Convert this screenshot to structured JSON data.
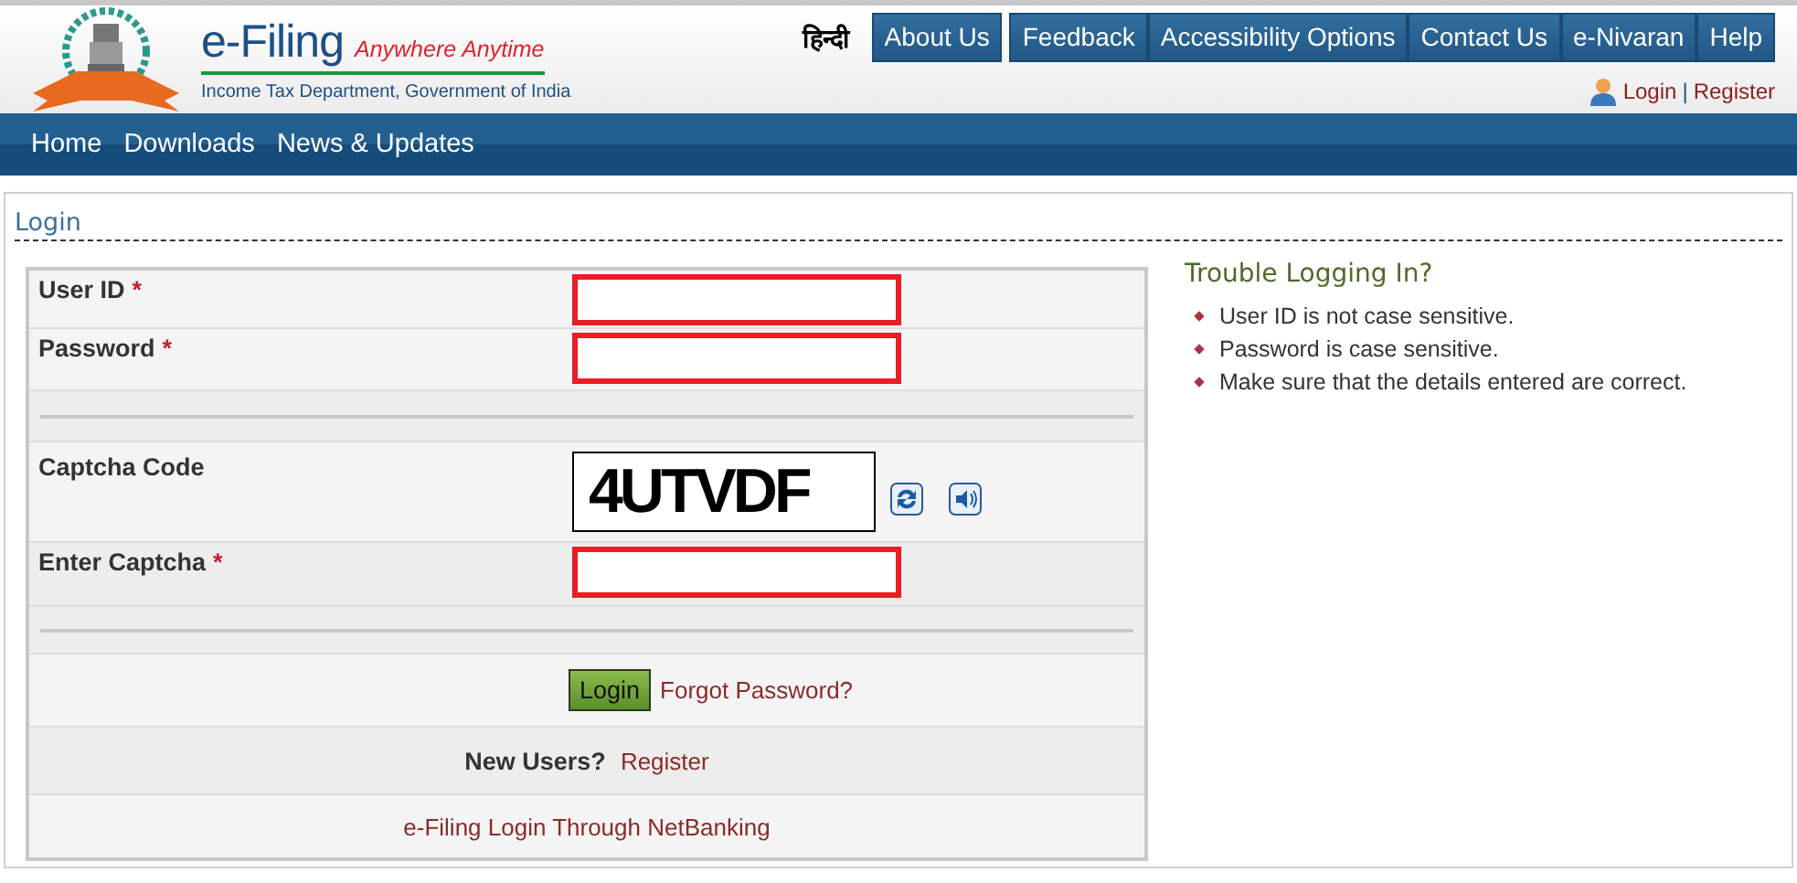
{
  "header": {
    "title": "e-Filing",
    "tagline": "Anywhere Anytime",
    "subtitle": "Income Tax Department, Government of India",
    "language": "हिन्दी",
    "top_menu": [
      "About Us",
      "Feedback",
      "Accessibility Options",
      "Contact Us",
      "e-Nivaran",
      "Help"
    ],
    "user_links": {
      "login": "Login",
      "separator": "|",
      "register": "Register"
    }
  },
  "nav": [
    "Home",
    "Downloads",
    "News & Updates"
  ],
  "login": {
    "heading": "Login",
    "required_mark": "*",
    "rows": [
      {
        "kind": "input",
        "label": "User ID",
        "required": true,
        "invalid": true
      },
      {
        "kind": "input",
        "label": "Password",
        "required": true,
        "invalid": true
      },
      {
        "kind": "separator"
      },
      {
        "kind": "captcha",
        "label": "Captcha Code",
        "code": "4UTVDF"
      },
      {
        "kind": "input",
        "label": "Enter Captcha",
        "required": true,
        "invalid": true
      },
      {
        "kind": "separator"
      }
    ],
    "button": "Login",
    "forgot": "Forgot Password?",
    "new_users": {
      "label": "New Users?",
      "link": "Register"
    },
    "netbanking": "e-Filing Login Through NetBanking"
  },
  "help": {
    "title": "Trouble Logging In?",
    "items": [
      "User ID is not case sensitive.",
      "Password is case sensitive.",
      "Make sure that the details entered are correct."
    ]
  }
}
